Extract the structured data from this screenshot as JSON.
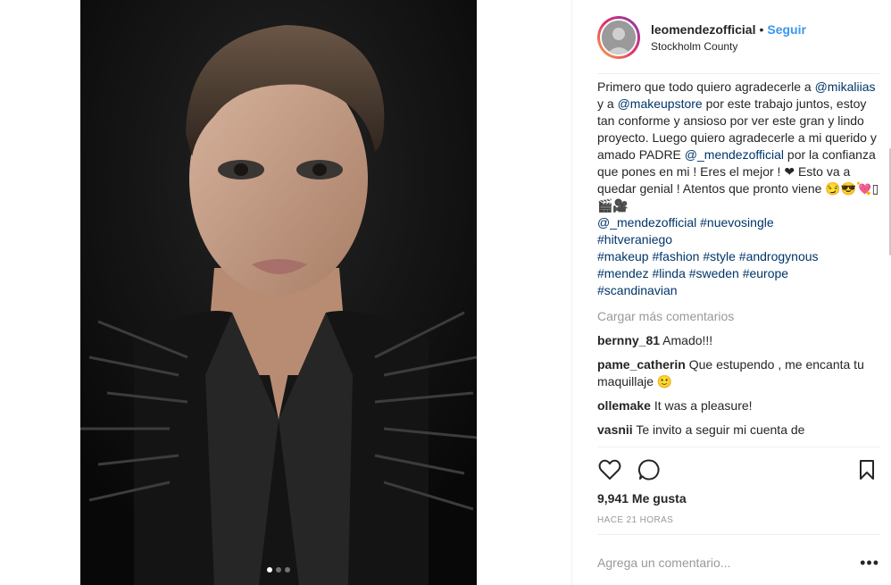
{
  "post": {
    "image_icon": "portrait-photo",
    "carousel": {
      "count": 3,
      "active": 1
    }
  },
  "header": {
    "username": "leomendezofficial",
    "separator": "•",
    "follow_label": "Seguir",
    "location": "Stockholm County"
  },
  "caption": {
    "parts": [
      {
        "text": "Primero que todo quiero agradecerle a ",
        "tag": false
      },
      {
        "text": "@mikaliias",
        "tag": true
      },
      {
        "text": " y a ",
        "tag": false
      },
      {
        "text": "@makeupstore",
        "tag": true
      },
      {
        "text": " por este trabajo juntos, estoy tan conforme y ansioso por ver este gran y lindo proyecto. Luego quiero agradecerle a mi querido y amado PADRE ",
        "tag": false
      },
      {
        "text": "@_mendezofficial",
        "tag": true
      },
      {
        "text": " por la confianza que pones en mi ! Eres el mejor ! ❤ Esto va a quedar genial ! Atentos que pronto viene 😏😎💘▯🎬🎥",
        "tag": false
      },
      {
        "text": "\n",
        "tag": false
      },
      {
        "text": "@_mendezofficial",
        "tag": true
      },
      {
        "text": " ",
        "tag": false
      },
      {
        "text": "#nuevosingle",
        "tag": true
      },
      {
        "text": "\n",
        "tag": false
      },
      {
        "text": "#hitveraniego",
        "tag": true
      },
      {
        "text": "\n",
        "tag": false
      },
      {
        "text": "#makeup",
        "tag": true
      },
      {
        "text": " ",
        "tag": false
      },
      {
        "text": "#fashion",
        "tag": true
      },
      {
        "text": " ",
        "tag": false
      },
      {
        "text": "#style",
        "tag": true
      },
      {
        "text": " ",
        "tag": false
      },
      {
        "text": "#androgynous",
        "tag": true
      },
      {
        "text": "\n",
        "tag": false
      },
      {
        "text": "#mendez",
        "tag": true
      },
      {
        "text": " ",
        "tag": false
      },
      {
        "text": "#linda",
        "tag": true
      },
      {
        "text": " ",
        "tag": false
      },
      {
        "text": "#sweden",
        "tag": true
      },
      {
        "text": " ",
        "tag": false
      },
      {
        "text": "#europe",
        "tag": true
      },
      {
        "text": "\n",
        "tag": false
      },
      {
        "text": "#scandinavian",
        "tag": true
      }
    ]
  },
  "load_more_label": "Cargar más comentarios",
  "comments": [
    {
      "user": "bernny_81",
      "text": "Amado!!!"
    },
    {
      "user": "pame_catherin",
      "text": "Que estupendo , me encanta tu maquillaje 🙂"
    },
    {
      "user": "ollemake",
      "text": "It was a pleasure!"
    },
    {
      "user": "vasnii",
      "text": "Te invito a seguir mi cuenta de"
    }
  ],
  "actions": {
    "like_icon": "heart-icon",
    "comment_icon": "comment-icon",
    "save_icon": "bookmark-icon"
  },
  "likes": "9,941 Me gusta",
  "timestamp": "HACE 21 HORAS",
  "add_comment": {
    "placeholder": "Agrega un comentario...",
    "more_icon": "•••"
  },
  "colors": {
    "link": "#3897f0",
    "tag": "#003569",
    "muted": "#999999",
    "text": "#262626"
  }
}
